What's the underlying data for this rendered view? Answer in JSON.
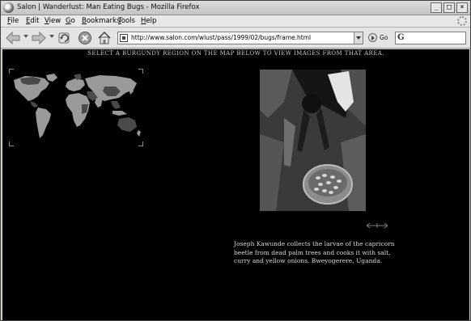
{
  "window": {
    "title": "Salon | Wanderlust: Man Eating Bugs - Mozilla Firefox",
    "minimize_label": "_",
    "maximize_label": "□",
    "close_label": "×"
  },
  "menu": {
    "items": [
      {
        "accel": "F",
        "rest": "ile"
      },
      {
        "accel": "E",
        "rest": "dit"
      },
      {
        "accel": "V",
        "rest": "iew"
      },
      {
        "accel": "G",
        "rest": "o"
      },
      {
        "accel": "B",
        "rest": "ookmarks"
      },
      {
        "accel": "T",
        "rest": "ools"
      },
      {
        "accel": "H",
        "rest": "elp"
      }
    ]
  },
  "toolbar": {
    "url": "http://www.salon.com/wlust/pass/1999/02/bugs/frame.html",
    "go_label": "Go",
    "search_logo": "G",
    "icons": [
      "back-icon",
      "forward-icon",
      "reload-icon",
      "stop-icon",
      "home-icon"
    ]
  },
  "page": {
    "instruction": "SELECT A BURGUNDY REGION ON THE MAP BELOW TO VIEW IMAGES FROM THAT AREA.",
    "caption": "Joseph Kawunde collects the larvae of the capricorn beetle from dead palm trees and cooks it with salt, curry and yellow onions. Bweyogerere, Uganda.",
    "arrows": "⟵⟶"
  },
  "colors": {
    "page_background": "#000000",
    "map_land_light": "#9a9a9a",
    "map_region_dark": "#4a4a4a",
    "text": "#c8c8c8"
  }
}
